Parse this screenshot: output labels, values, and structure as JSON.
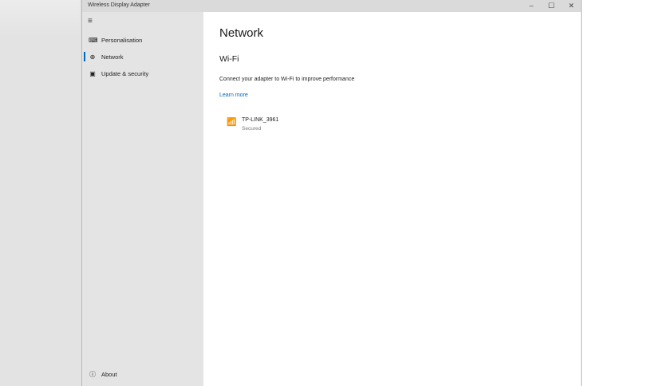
{
  "window": {
    "title": "Wireless Display Adapter",
    "minimize": "–",
    "maximize": "☐",
    "close": "✕"
  },
  "sidebar": {
    "menu_icon": "≡",
    "items": [
      {
        "label": "Personalisation",
        "icon": "personalisation-icon",
        "glyph": "⌨"
      },
      {
        "label": "Network",
        "icon": "globe-icon",
        "glyph": "⊕"
      },
      {
        "label": "Update & security",
        "icon": "update-icon",
        "glyph": "▣"
      }
    ],
    "about": {
      "label": "About",
      "glyph": "ⓘ"
    }
  },
  "main": {
    "title": "Network",
    "section": "Wi-Fi",
    "description": "Connect your adapter to Wi-Fi to improve performance",
    "learn_more": "Learn more",
    "networks": [
      {
        "name": "TP-LINK_3961",
        "status": "Secured",
        "glyph": "📶"
      }
    ]
  },
  "colors": {
    "accent": "#0067c0"
  }
}
